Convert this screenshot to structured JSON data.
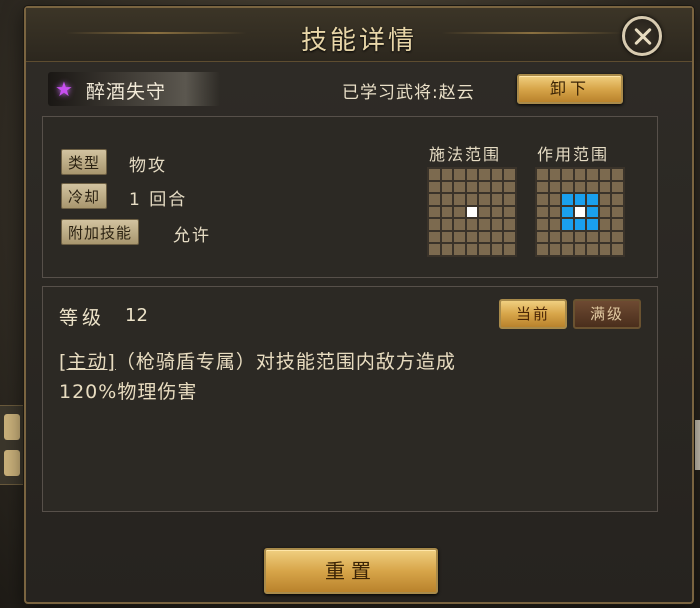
{
  "dialog": {
    "title": "技能详情",
    "skill_name": "醉酒失守",
    "learned_by": "已学习武将:赵云",
    "unequip_label": "卸下",
    "reset_label": "重置"
  },
  "info": {
    "type_tag": "类型",
    "type_value": "物攻",
    "cooldown_tag": "冷却",
    "cooldown_value": "1 回合",
    "extra_tag": "附加技能",
    "extra_value": "允许",
    "cast_range_label": "施法范围",
    "effect_range_label": "作用范围"
  },
  "detail": {
    "level_label": "等级",
    "level_value": "12",
    "tab_current": "当前",
    "tab_max": "满级",
    "desc_tag": "[主动]",
    "desc_line1_rest": "（枪骑盾专属）对技能范围内敌方造成",
    "desc_line2": "120%物理伤害"
  },
  "icons": {
    "skill_icon": "purple-star-icon",
    "close_icon": "close-icon"
  },
  "colors": {
    "gold": "#d7a549",
    "range_blue": "#1aa0ee",
    "skill_purple": "#c84ff0"
  },
  "ranges": {
    "grid_size": 7,
    "cast_center": [
      3,
      3
    ],
    "effect_cells": [
      [
        2,
        2
      ],
      [
        2,
        3
      ],
      [
        2,
        4
      ],
      [
        3,
        2
      ],
      [
        3,
        4
      ],
      [
        4,
        2
      ],
      [
        4,
        3
      ],
      [
        4,
        4
      ]
    ],
    "effect_center": [
      3,
      3
    ]
  }
}
